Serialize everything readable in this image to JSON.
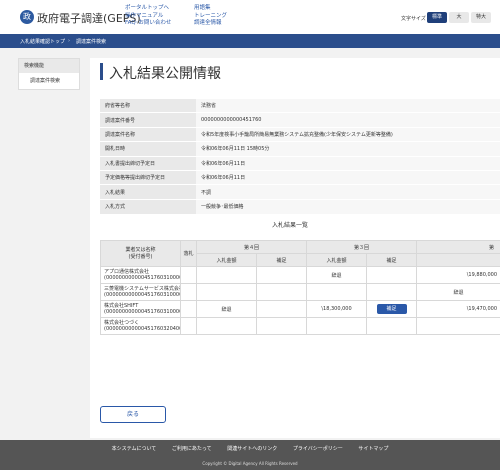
{
  "header": {
    "logo_glyph": "政",
    "site_title": "政府電子調達(GEPS)",
    "links_col1": [
      "ポータルトップへ",
      "操作マニュアル",
      "FAQ･お問い合わせ"
    ],
    "links_col2": [
      "用語集",
      "トレーニング",
      "調達全情報"
    ],
    "font_size_label": "文字サイズ",
    "font_sizes": [
      "標準",
      "大",
      "特大"
    ],
    "font_size_selected": "標準"
  },
  "breadcrumb": [
    "入札結果確認トップ",
    "調達案件検索"
  ],
  "sidebar": {
    "heading": "検索機能",
    "items": [
      "調達案件検索"
    ]
  },
  "page_title": "入札結果公開情報",
  "info": [
    {
      "label": "府省等名称",
      "value": "法務省"
    },
    {
      "label": "調達案件番号",
      "value": "0000000000000451760"
    },
    {
      "label": "調達案件名称",
      "value": "令和5年度検事小手籠局所簡易無業務システム拡充整備(少年保安システム更新等整備)"
    },
    {
      "label": "開札日時",
      "value": "令和06年06月11日 15時05分"
    },
    {
      "label": "入札書提出締切予定日",
      "value": "令和06年06月11日"
    },
    {
      "label": "予定価格等提出締切予定日",
      "value": "令和06年06月11日"
    },
    {
      "label": "入札結果",
      "value": "不調"
    },
    {
      "label": "入札方式",
      "value": "一般競争･最低価格"
    }
  ],
  "results": {
    "title": "入札結果一覧",
    "col_name": "業者又は名称",
    "col_name_sub": "(受付番号)",
    "col_ra": "落札",
    "round4": "第４回",
    "round3": "第３回",
    "round_next": "第",
    "col_amount": "入札金額",
    "col_note": "補足",
    "rows": [
      {
        "name": "アプロ通信株式会社",
        "id": "(0000000000004517603100002)",
        "r4_amount": "",
        "r4_note": "",
        "r3_amount": "辞退",
        "r3_note": "",
        "next": "\\19,880,000"
      },
      {
        "name": "三菱電機システムサービス株式会社",
        "id": "(0000000000004517603100001)",
        "r4_amount": "",
        "r4_note": "",
        "r3_amount": "",
        "r3_note": "",
        "next": "辞退"
      },
      {
        "name": "株式会社SHIFT",
        "id": "(0000000000004517603100003)",
        "r4_amount": "辞退",
        "r4_note": "",
        "r3_amount": "\\18,300,000",
        "r3_note": "補足",
        "next": "\\19,470,000"
      },
      {
        "name": "株式会社つづく",
        "id": "(0000000000004517603204001)",
        "r4_amount": "",
        "r4_note": "",
        "r3_amount": "",
        "r3_note": "",
        "next": ""
      }
    ]
  },
  "back_label": "戻る",
  "footer": {
    "links": [
      "本システムについて",
      "ご利用にあたって",
      "関連サイトへのリンク",
      "プライバシーポリシー",
      "サイトマップ"
    ],
    "copyright": "Copyright © Digital Agency All Rights Reserved"
  }
}
